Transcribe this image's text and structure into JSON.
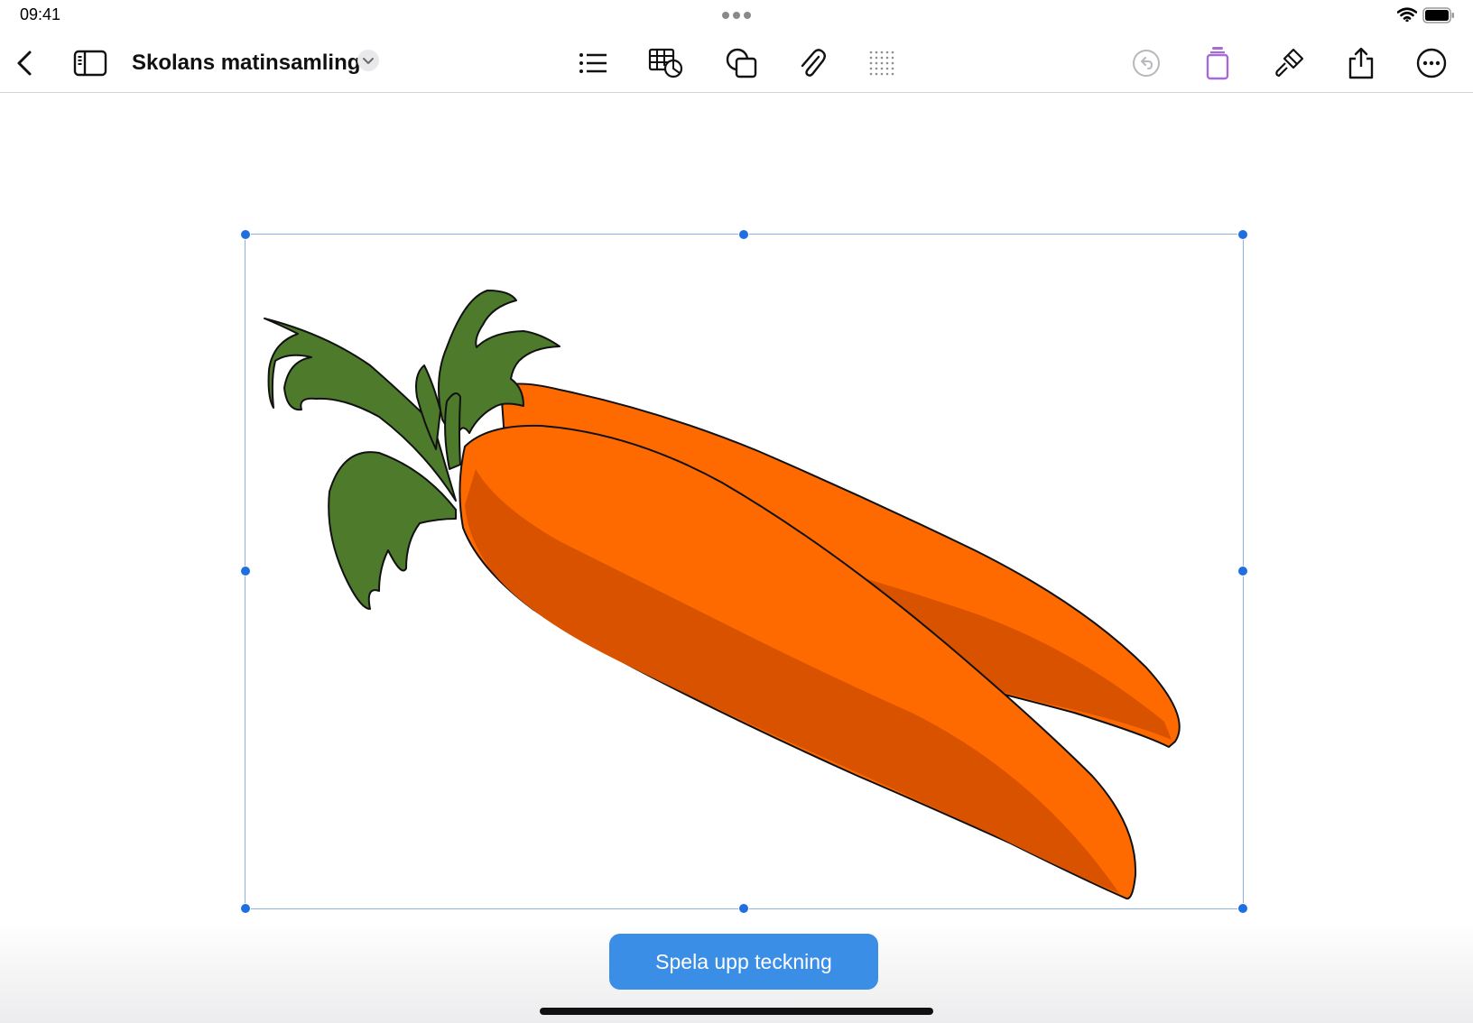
{
  "status_bar": {
    "time": "09:41"
  },
  "header": {
    "title": "Skolans matinsamling",
    "icons": {
      "back": "chevron-left-icon",
      "sidebar": "sidebar-icon",
      "title_menu": "chevron-down-icon",
      "list": "list-icon",
      "table_chart": "table-chart-icon",
      "shapes": "shapes-icon",
      "attach": "paperclip-icon",
      "grid": "dot-grid-icon",
      "undo": "undo-icon",
      "pen_tool": "pen-tool-icon",
      "format": "paintbrush-icon",
      "share": "share-icon",
      "more": "more-icon"
    }
  },
  "canvas": {
    "drawing": "carrot-drawing"
  },
  "playback": {
    "label": "Spela upp teckning"
  },
  "colors": {
    "accent": "#3a8ee6",
    "selection": "#1f6fe0",
    "pen_tool": "#a56bd6",
    "carrot": "#ff6a00",
    "carrot_shadow": "#d95200",
    "leaf": "#4e7a2c"
  }
}
